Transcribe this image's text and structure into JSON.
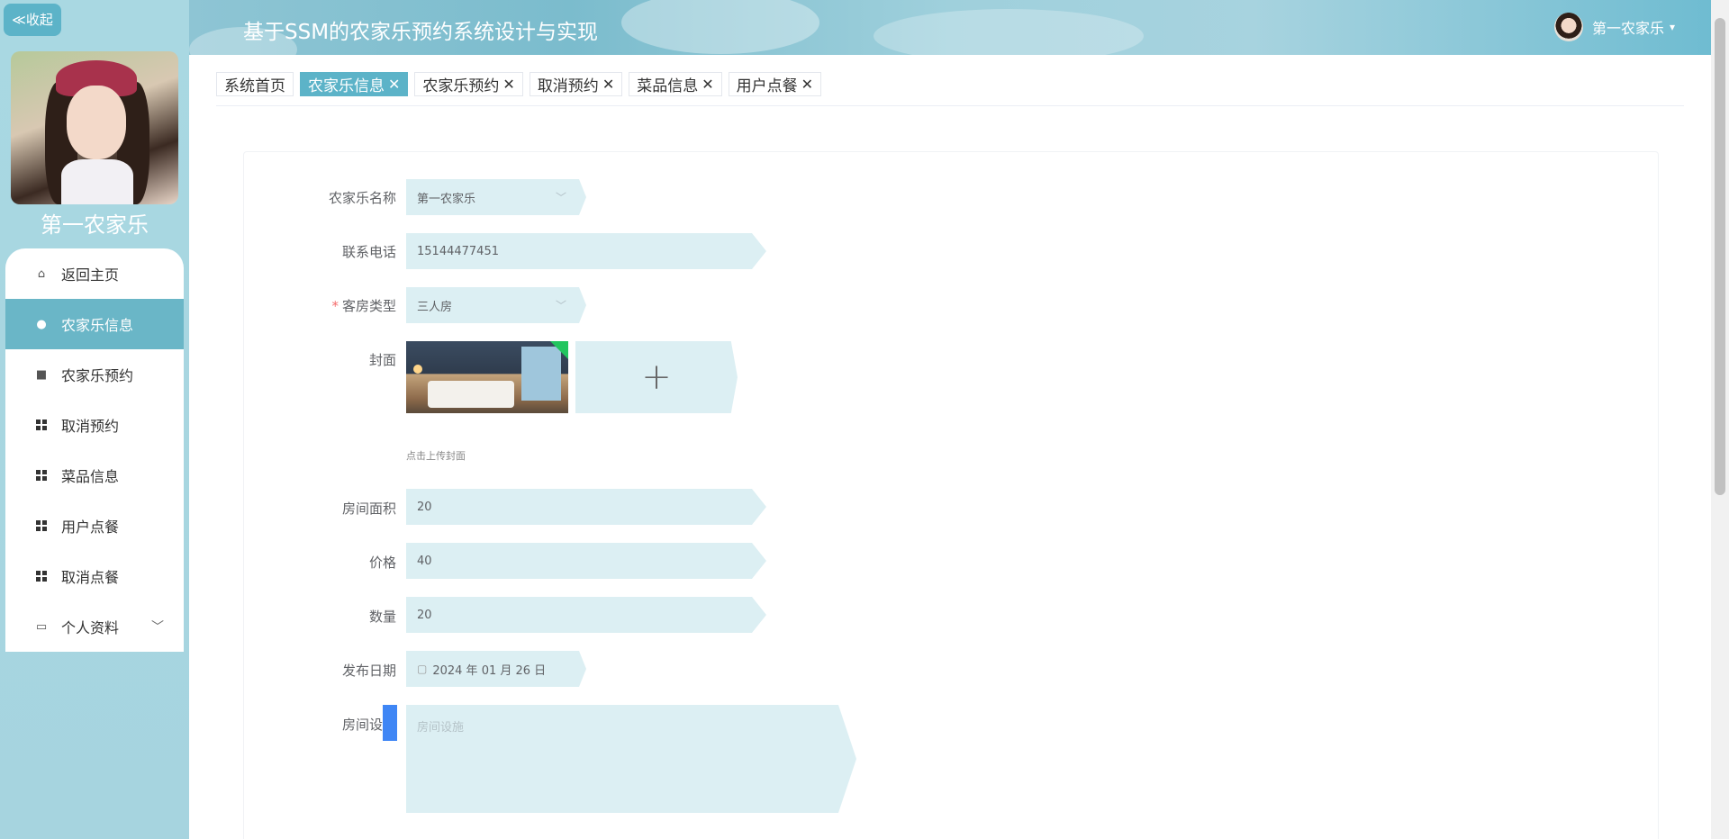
{
  "sidebar": {
    "collapse_label": "≪收起",
    "username": "第一农家乐",
    "items": [
      {
        "label": "返回主页"
      },
      {
        "label": "农家乐信息"
      },
      {
        "label": "农家乐预约"
      },
      {
        "label": "取消预约"
      },
      {
        "label": "菜品信息"
      },
      {
        "label": "用户点餐"
      },
      {
        "label": "取消点餐"
      },
      {
        "label": "个人资料"
      }
    ]
  },
  "header": {
    "title": "基于SSM的农家乐预约系统设计与实现",
    "user": "第一农家乐"
  },
  "tabs": [
    {
      "label": "系统首页"
    },
    {
      "label": "农家乐信息"
    },
    {
      "label": "农家乐预约"
    },
    {
      "label": "取消预约"
    },
    {
      "label": "菜品信息"
    },
    {
      "label": "用户点餐"
    }
  ],
  "form": {
    "name_label": "农家乐名称",
    "name_value": "第一农家乐",
    "phone_label": "联系电话",
    "phone_value": "15144477451",
    "room_type_label": "客房类型",
    "room_type_value": "三人房",
    "cover_label": "封面",
    "cover_hint": "点击上传封面",
    "area_label": "房间面积",
    "area_value": "20",
    "price_label": "价格",
    "price_value": "40",
    "qty_label": "数量",
    "qty_value": "20",
    "date_label": "发布日期",
    "date_value": "2024 年 01 月 26 日",
    "facility_label": "房间设施",
    "facility_placeholder": "房间设施"
  }
}
